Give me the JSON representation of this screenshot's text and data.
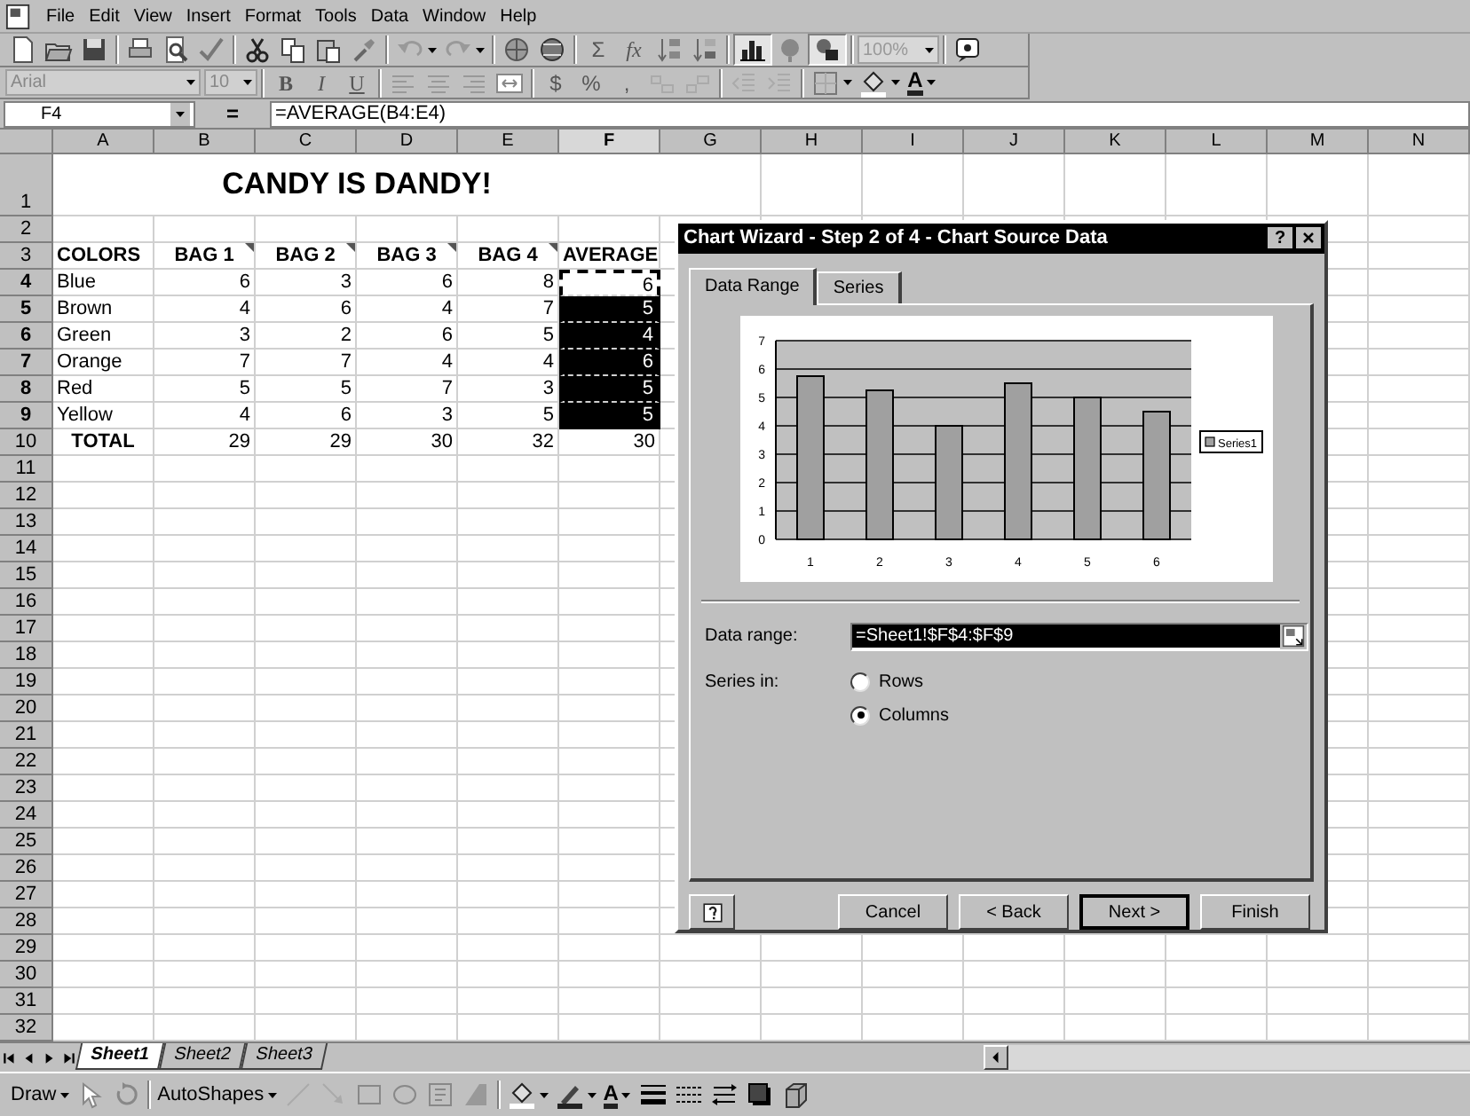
{
  "menu_bar": {
    "items": [
      "File",
      "Edit",
      "View",
      "Insert",
      "Format",
      "Tools",
      "Data",
      "Window",
      "Help"
    ]
  },
  "standard_toolbar": {
    "sum": "Σ",
    "function": "fx",
    "zoom": "100%",
    "chart_wizard_pressed": true,
    "drawing_pressed": true
  },
  "formatting_toolbar": {
    "font": "Arial",
    "size": "10",
    "bold": "B",
    "italic": "I",
    "underline": "U",
    "currency": "$",
    "percent": "%",
    "comma": ",",
    "font_color": "A"
  },
  "formula_bar": {
    "name_box": "F4",
    "equals": "=",
    "formula": "=AVERAGE(B4:E4)"
  },
  "sheet": {
    "columns": [
      {
        "label": "A",
        "selected": false
      },
      {
        "label": "B",
        "selected": false
      },
      {
        "label": "C",
        "selected": false
      },
      {
        "label": "D",
        "selected": false
      },
      {
        "label": "E",
        "selected": false
      },
      {
        "label": "F",
        "selected": true
      },
      {
        "label": "G",
        "selected": false
      },
      {
        "label": "H",
        "selected": false
      },
      {
        "label": "I",
        "selected": false
      },
      {
        "label": "J",
        "selected": false
      },
      {
        "label": "K",
        "selected": false
      },
      {
        "label": "L",
        "selected": false
      },
      {
        "label": "M",
        "selected": false
      },
      {
        "label": "N",
        "selected": false
      }
    ],
    "rows": [
      {
        "number": "1",
        "selected": false,
        "kind": "title",
        "cells": [
          "CANDY IS DANDY!"
        ]
      },
      {
        "number": "2",
        "selected": false,
        "kind": "blank"
      },
      {
        "number": "3",
        "selected": false,
        "kind": "header",
        "cells": [
          "COLORS",
          "BAG 1",
          "BAG 2",
          "BAG 3",
          "BAG 4",
          "AVERAGE"
        ],
        "comments": [
          false,
          true,
          true,
          true,
          true,
          false
        ]
      },
      {
        "number": "4",
        "selected": true,
        "kind": "data",
        "cells": [
          "Blue",
          "6",
          "3",
          "6",
          "8",
          "6"
        ],
        "in_range": true,
        "highlighted": false
      },
      {
        "number": "5",
        "selected": true,
        "kind": "data",
        "cells": [
          "Brown",
          "4",
          "6",
          "4",
          "7",
          "5"
        ],
        "in_range": true,
        "highlighted": true
      },
      {
        "number": "6",
        "selected": true,
        "kind": "data",
        "cells": [
          "Green",
          "3",
          "2",
          "6",
          "5",
          "4"
        ],
        "in_range": true,
        "highlighted": true
      },
      {
        "number": "7",
        "selected": true,
        "kind": "data",
        "cells": [
          "Orange",
          "7",
          "7",
          "4",
          "4",
          "6"
        ],
        "in_range": true,
        "highlighted": true
      },
      {
        "number": "8",
        "selected": true,
        "kind": "data",
        "cells": [
          "Red",
          "5",
          "5",
          "7",
          "3",
          "5"
        ],
        "in_range": true,
        "highlighted": true
      },
      {
        "number": "9",
        "selected": true,
        "kind": "data",
        "cells": [
          "Yellow",
          "4",
          "6",
          "3",
          "5",
          "5"
        ],
        "in_range": true,
        "highlighted": true
      },
      {
        "number": "10",
        "selected": false,
        "kind": "total",
        "cells": [
          "TOTAL",
          "29",
          "29",
          "30",
          "32",
          "30"
        ]
      },
      {
        "number": "11",
        "selected": false,
        "kind": "blank"
      },
      {
        "number": "12",
        "selected": false,
        "kind": "blank"
      },
      {
        "number": "13",
        "selected": false,
        "kind": "blank"
      },
      {
        "number": "14",
        "selected": false,
        "kind": "blank"
      },
      {
        "number": "15",
        "selected": false,
        "kind": "blank"
      },
      {
        "number": "16",
        "selected": false,
        "kind": "blank"
      },
      {
        "number": "17",
        "selected": false,
        "kind": "blank"
      },
      {
        "number": "18",
        "selected": false,
        "kind": "blank"
      },
      {
        "number": "19",
        "selected": false,
        "kind": "blank"
      },
      {
        "number": "20",
        "selected": false,
        "kind": "blank"
      },
      {
        "number": "21",
        "selected": false,
        "kind": "blank"
      },
      {
        "number": "22",
        "selected": false,
        "kind": "blank"
      },
      {
        "number": "23",
        "selected": false,
        "kind": "blank"
      },
      {
        "number": "24",
        "selected": false,
        "kind": "blank"
      },
      {
        "number": "25",
        "selected": false,
        "kind": "blank"
      },
      {
        "number": "26",
        "selected": false,
        "kind": "blank"
      },
      {
        "number": "27",
        "selected": false,
        "kind": "blank"
      },
      {
        "number": "28",
        "selected": false,
        "kind": "blank"
      },
      {
        "number": "29",
        "selected": false,
        "kind": "blank"
      },
      {
        "number": "30",
        "selected": false,
        "kind": "blank"
      },
      {
        "number": "31",
        "selected": false,
        "kind": "blank"
      },
      {
        "number": "32",
        "selected": false,
        "kind": "blank"
      }
    ]
  },
  "sheet_tabs": [
    {
      "label": "Sheet1",
      "selected": true
    },
    {
      "label": "Sheet2",
      "selected": false
    },
    {
      "label": "Sheet3",
      "selected": false
    }
  ],
  "drawing_toolbar": {
    "draw": "Draw",
    "autoshapes": "AutoShapes",
    "font_color": "A"
  },
  "chart_wizard": {
    "title": "Chart Wizard - Step 2 of 4 - Chart Source Data",
    "help_button": "?",
    "tabs": [
      {
        "label": "Data Range",
        "selected": true
      },
      {
        "label": "Series",
        "selected": false
      }
    ],
    "chart_data": {
      "type": "bar",
      "categories": [
        "1",
        "2",
        "3",
        "4",
        "5",
        "6"
      ],
      "series": [
        {
          "name": "Series1",
          "color": "#a0a0a0",
          "values": [
            5.75,
            5.25,
            4,
            5.5,
            5,
            4.5
          ]
        }
      ],
      "ylim": [
        0,
        7
      ],
      "yticks": [
        0,
        1,
        2,
        3,
        4,
        5,
        6,
        7
      ],
      "grid": true
    },
    "data_range": {
      "label": "Data range:",
      "value": "=Sheet1!$F$4:$F$9",
      "text_selected": true
    },
    "series_in": {
      "label": "Series in:",
      "options": [
        {
          "label": "Rows",
          "selected": false
        },
        {
          "label": "Columns",
          "selected": true
        }
      ]
    },
    "buttons": [
      {
        "label": "Cancel",
        "default": false
      },
      {
        "label": "< Back",
        "default": false
      },
      {
        "label": "Next >",
        "default": true
      },
      {
        "label": "Finish",
        "default": false
      }
    ]
  }
}
